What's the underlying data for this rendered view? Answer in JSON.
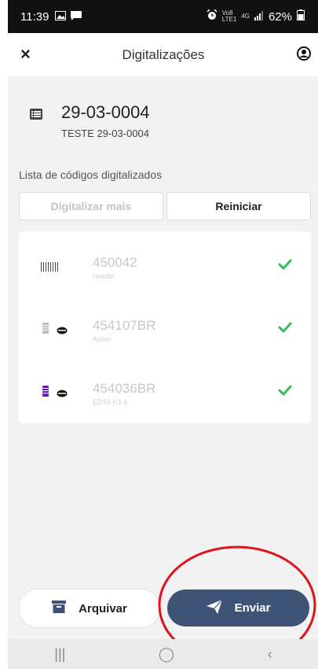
{
  "status_bar": {
    "time": "11:39",
    "network_top": "Vo8",
    "network_bottom": "LTE1",
    "network_type": "4G",
    "battery": "62%"
  },
  "header": {
    "title": "Digitalizações",
    "close_icon": "close-icon",
    "user_icon": "user-icon"
  },
  "document": {
    "code": "29-03-0004",
    "subtitle": "TESTE 29-03-0004",
    "icon": "list-icon"
  },
  "list_title": "Lista de códigos digitalizados",
  "buttons": {
    "scan_more": "Digitalizar mais",
    "restart": "Reiniciar"
  },
  "items": [
    {
      "code": "450042",
      "desc": "needle",
      "icon": "barcode-icon"
    },
    {
      "code": "454107BR",
      "desc": "Apoio",
      "icon": "tube-icon",
      "tube_color": "#bdbdbd"
    },
    {
      "code": "454036BR",
      "desc": "EDTA K3 4",
      "icon": "tube-icon",
      "tube_color": "#6a1fb0"
    }
  ],
  "actions": {
    "archive": "Arquivar",
    "send": "Enviar"
  },
  "nav": {
    "recent": "|||",
    "home": "◯",
    "back": "‹"
  },
  "colors": {
    "primary_button": "#3f5377",
    "check": "#2fbe5a",
    "annotation": "#e0131a"
  }
}
